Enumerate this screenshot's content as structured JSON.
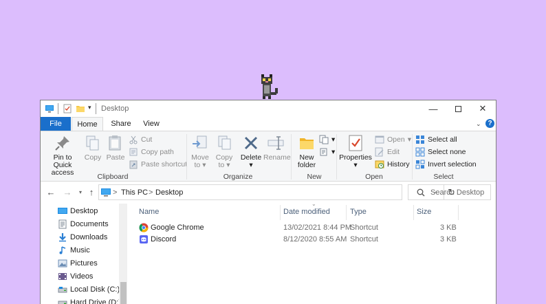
{
  "window": {
    "title": "Desktop",
    "minimize_icon": "minimize-icon",
    "maximize_icon": "maximize-icon",
    "close_icon": "close-icon"
  },
  "ribbon_tabs": {
    "file": "File",
    "home": "Home",
    "share": "Share",
    "view": "View",
    "help": "?"
  },
  "ribbon": {
    "clipboard": {
      "label": "Clipboard",
      "pin_line1": "Pin to Quick",
      "pin_line2": "access",
      "copy": "Copy",
      "paste": "Paste",
      "cut": "Cut",
      "copy_path": "Copy path",
      "paste_shortcut": "Paste shortcut"
    },
    "organize": {
      "label": "Organize",
      "move_to_line1": "Move",
      "move_to_line2": "to",
      "copy_to_line1": "Copy",
      "copy_to_line2": "to",
      "delete": "Delete",
      "rename": "Rename"
    },
    "new": {
      "label": "New",
      "new_folder_line1": "New",
      "new_folder_line2": "folder"
    },
    "open": {
      "label": "Open",
      "properties": "Properties",
      "open": "Open",
      "edit": "Edit",
      "history": "History"
    },
    "select": {
      "label": "Select",
      "select_all": "Select all",
      "select_none": "Select none",
      "invert_selection": "Invert selection"
    }
  },
  "address": {
    "path": [
      "This PC",
      "Desktop"
    ],
    "separator": ">",
    "search_placeholder": "Search Desktop"
  },
  "nav_pane": {
    "items": [
      {
        "label": "Desktop",
        "icon": "desktop-icon"
      },
      {
        "label": "Documents",
        "icon": "documents-icon"
      },
      {
        "label": "Downloads",
        "icon": "downloads-icon"
      },
      {
        "label": "Music",
        "icon": "music-icon"
      },
      {
        "label": "Pictures",
        "icon": "pictures-icon"
      },
      {
        "label": "Videos",
        "icon": "videos-icon"
      },
      {
        "label": "Local Disk (C:)",
        "icon": "local-disk-icon"
      },
      {
        "label": "Hard Drive (D:)",
        "icon": "hard-drive-icon"
      }
    ]
  },
  "file_list": {
    "columns": [
      "Name",
      "Date modified",
      "Type",
      "Size"
    ],
    "rows": [
      {
        "name": "Google Chrome",
        "date": "13/02/2021 8:44 PM",
        "type": "Shortcut",
        "size": "3 KB",
        "icon": "chrome-icon"
      },
      {
        "name": "Discord",
        "date": "8/12/2020 8:55 AM",
        "type": "Shortcut",
        "size": "3 KB",
        "icon": "discord-icon"
      }
    ]
  },
  "colors": {
    "desktop_background": "#dcbdfd",
    "accent": "#1a6fcb",
    "ribbon_background": "#f5f6f7"
  }
}
